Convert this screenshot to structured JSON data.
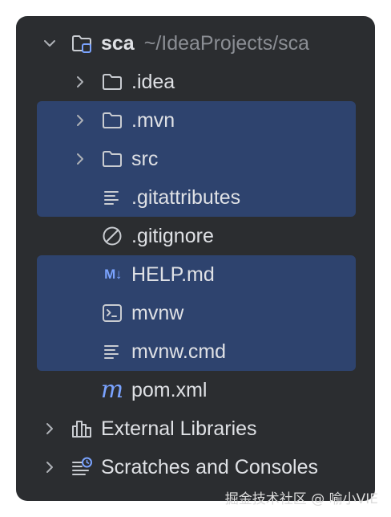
{
  "project": {
    "name": "sca",
    "path": "~/IdeaProjects/sca",
    "items": [
      {
        "label": ".idea"
      },
      {
        "label": ".mvn"
      },
      {
        "label": "src"
      },
      {
        "label": ".gitattributes"
      },
      {
        "label": ".gitignore"
      },
      {
        "label": "HELP.md",
        "badge": "M↓"
      },
      {
        "label": "mvnw"
      },
      {
        "label": "mvnw.cmd"
      },
      {
        "label": "pom.xml",
        "badge": "m"
      }
    ]
  },
  "external_libraries": {
    "label": "External Libraries"
  },
  "scratches": {
    "label": "Scratches and Consoles"
  },
  "watermark": "掘金技术社区 @ 喻小VIE",
  "colors": {
    "panel_bg": "#2b2d30",
    "selection": "#2e436e",
    "text": "#dfe1e5",
    "muted": "#8b8e94",
    "accent": "#7aa3ff"
  }
}
